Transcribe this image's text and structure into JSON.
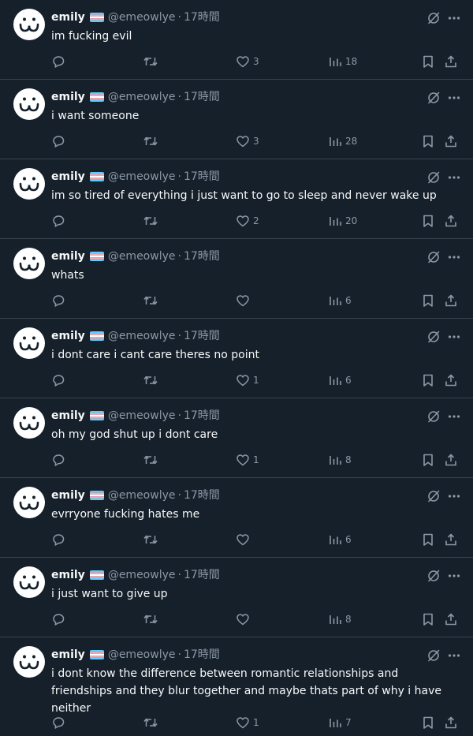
{
  "user": {
    "name": "emily",
    "handle": "@emeowlye",
    "time": "17時間",
    "separator": "·",
    "flag": "trans-flag"
  },
  "colors": {
    "background": "#15202b",
    "divider": "#38444d",
    "text": "#f7f9f9",
    "muted": "#8b98a5",
    "flag_blue": "#5bcefa",
    "flag_pink": "#f5a9b8"
  },
  "icons": {
    "top": [
      "grok-slash-icon",
      "more-icon"
    ],
    "actions": [
      "reply-icon",
      "retweet-icon",
      "like-icon",
      "views-icon",
      "bookmark-icon",
      "share-icon"
    ]
  },
  "posts": [
    {
      "text": "im fucking evil",
      "likes": "3",
      "views": "18"
    },
    {
      "text": "i want someone",
      "likes": "3",
      "views": "28"
    },
    {
      "text": "im so tired of everything i just want to go to sleep and never wake up",
      "likes": "2",
      "views": "20"
    },
    {
      "text": "whats",
      "likes": "",
      "views": "6"
    },
    {
      "text": "i dont care i cant care theres no point",
      "likes": "1",
      "views": "6"
    },
    {
      "text": "oh my god shut up i dont care",
      "likes": "1",
      "views": "8"
    },
    {
      "text": "evrryone fucking hates me",
      "likes": "",
      "views": "6"
    },
    {
      "text": "i just want to give up",
      "likes": "",
      "views": "8"
    },
    {
      "text": "i dont know the difference between romantic relationships and friendships and they blur together and maybe thats part of why i have neither",
      "likes": "1",
      "views": "7"
    }
  ]
}
